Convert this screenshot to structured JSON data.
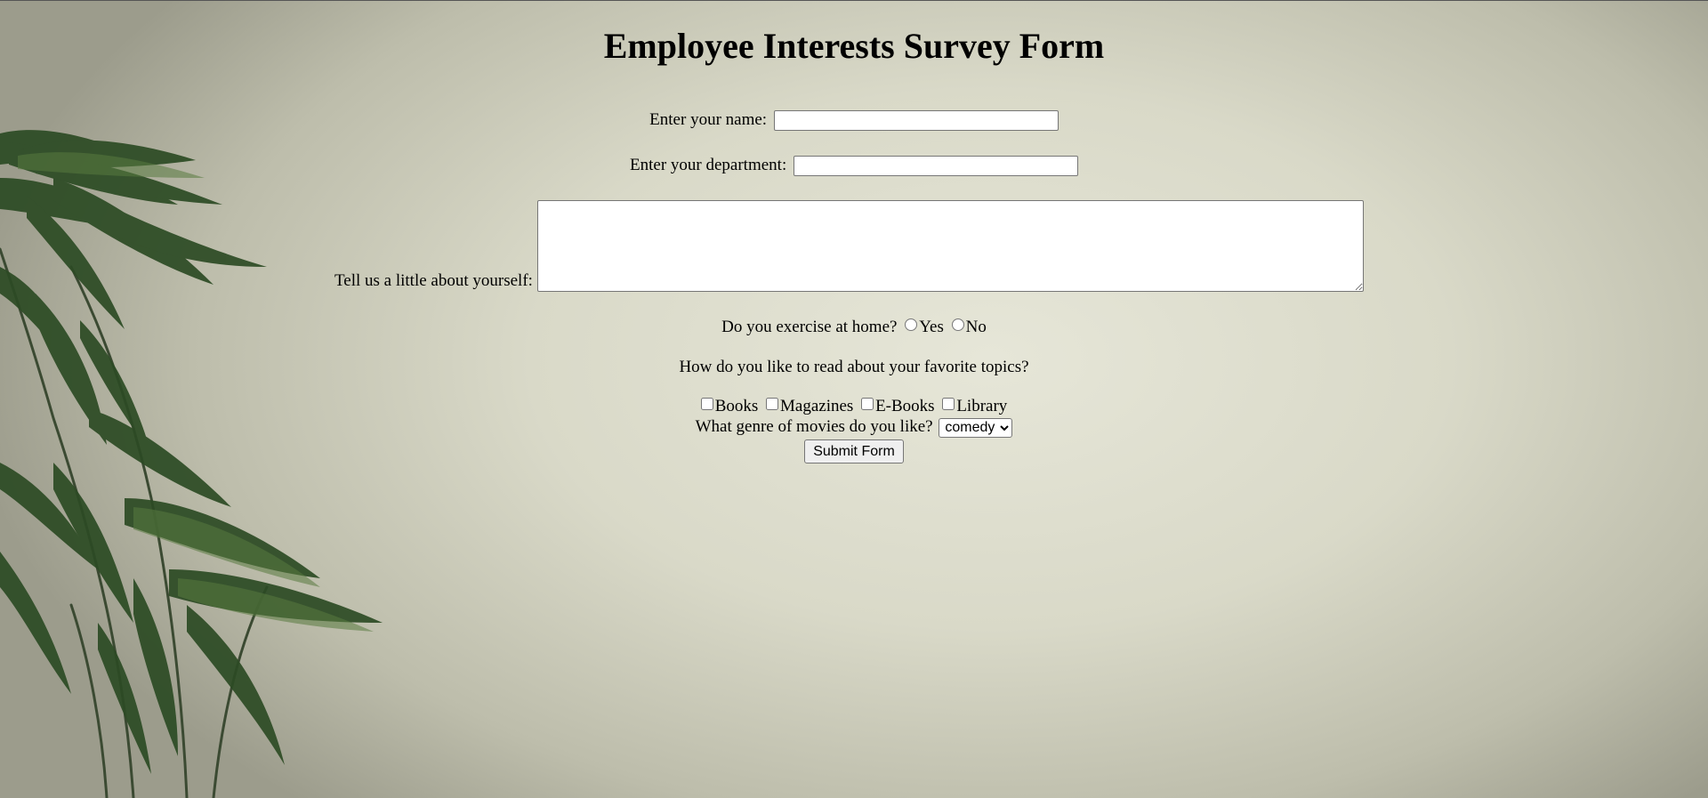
{
  "form": {
    "title": "Employee Interests Survey Form",
    "name_label": "Enter your name:",
    "name_value": "",
    "department_label": "Enter your department:",
    "department_value": "",
    "about_label": "Tell us a little about yourself:",
    "about_value": "",
    "exercise_question": "Do you exercise at home?",
    "exercise_options": [
      "Yes",
      "No"
    ],
    "reading_question": "How do you like to read about your favorite topics?",
    "reading_options": [
      "Books",
      "Magazines",
      "E-Books",
      "Library"
    ],
    "movies_question": "What genre of movies do you like?",
    "movies_selected": "comedy",
    "submit_label": "Submit Form"
  },
  "background": {
    "description_icon": "plant-photo-icon",
    "wall_color": "#e3e3d4",
    "plant_color": "#2f4a2a"
  }
}
